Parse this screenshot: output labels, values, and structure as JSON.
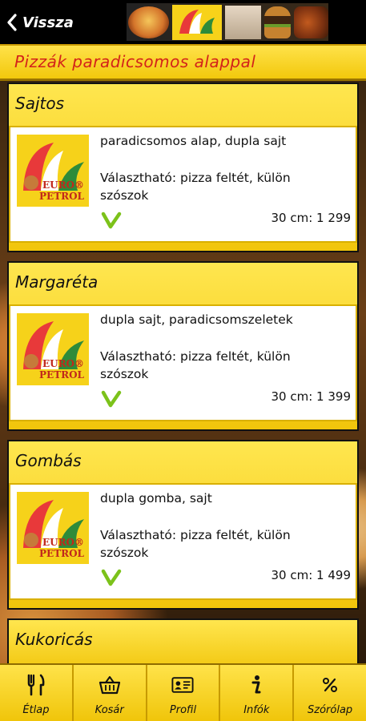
{
  "header": {
    "back_label": "Vissza",
    "page_title": "Pizzák paradicsomos alappal"
  },
  "logo_text": {
    "line1": "EURO®",
    "line2": "PETROL"
  },
  "items": [
    {
      "name": "Sajtos",
      "description": "paradicsomos alap, dupla sajt",
      "option": "Választható: pizza feltét, külön szószok",
      "price": "30 cm: 1 299"
    },
    {
      "name": "Margaréta",
      "description": "dupla sajt, paradicsomszeletek",
      "option": "Választható: pizza feltét, külön szószok",
      "price": "30 cm: 1 399"
    },
    {
      "name": "Gombás",
      "description": "dupla gomba, sajt",
      "option": "Választható: pizza feltét, külön szószok",
      "price": "30 cm: 1 499"
    },
    {
      "name": "Kukoricás"
    }
  ],
  "tabs": [
    {
      "label": "Étlap",
      "icon": "cutlery-icon"
    },
    {
      "label": "Kosár",
      "icon": "basket-icon"
    },
    {
      "label": "Profil",
      "icon": "id-card-icon"
    },
    {
      "label": "Infók",
      "icon": "info-icon"
    },
    {
      "label": "Szórólap",
      "icon": "percent-icon"
    }
  ],
  "colors": {
    "accent_yellow": "#f2c80c",
    "title_red": "#d3221a",
    "check_green": "#7cc21a"
  }
}
